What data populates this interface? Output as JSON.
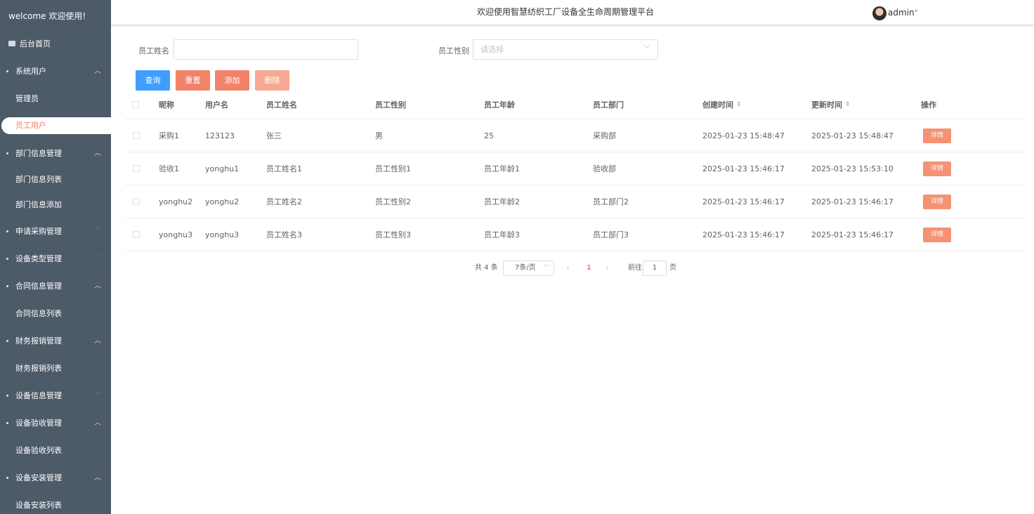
{
  "sidebar": {
    "welcome": "welcome 欢迎使用!",
    "home": "后台首页",
    "groups": [
      {
        "label": "系统用户",
        "children": [
          "管理员"
        ],
        "active_child": "员工用户"
      },
      {
        "label": "部门信息管理",
        "children": [
          "部门信息列表",
          "部门信息添加"
        ]
      },
      {
        "label": "申请采购管理"
      },
      {
        "label": "设备类型管理"
      },
      {
        "label": "合同信息管理",
        "children": [
          "合同信息列表"
        ]
      },
      {
        "label": "财务报销管理",
        "children": [
          "财务报销列表"
        ]
      },
      {
        "label": "设备信息管理"
      },
      {
        "label": "设备验收管理",
        "children": [
          "设备验收列表"
        ]
      },
      {
        "label": "设备安装管理",
        "children": [
          "设备安装列表"
        ]
      }
    ]
  },
  "header": {
    "title": "欢迎使用智慧纺织工厂设备全生命周期管理平台",
    "user": "admin",
    "user_caret": "˅"
  },
  "search": {
    "name_label": "员工姓名",
    "name_value": "",
    "gender_label": "员工性别",
    "gender_placeholder": "请选择"
  },
  "buttons": {
    "query": "查询",
    "reset": "重置",
    "add": "添加",
    "delete": "删除"
  },
  "colors": {
    "sidebar_bg": "#4d5a68",
    "primary": "#409eff",
    "accent": "#f2836b",
    "delete_disabled": "#f7a891",
    "detail_btn": "#f59274"
  },
  "table": {
    "headers": [
      "昵称",
      "用户名",
      "员工姓名",
      "员工性别",
      "员工年龄",
      "员工部门",
      "创建时间",
      "更新时间",
      "操作"
    ],
    "sort_icon": "⇕",
    "rows": [
      {
        "nickname": "采购1",
        "username": "123123",
        "name": "张三",
        "gender": "男",
        "age": "25",
        "dept": "采购部",
        "created": "2025-01-23 15:48:47",
        "updated": "2025-01-23 15:48:47",
        "action": "详情"
      },
      {
        "nickname": "验收1",
        "username": "yonghu1",
        "name": "员工姓名1",
        "gender": "员工性别1",
        "age": "员工年龄1",
        "dept": "验收部",
        "created": "2025-01-23 15:46:17",
        "updated": "2025-01-23 15:53:10",
        "action": "详情"
      },
      {
        "nickname": "yonghu2",
        "username": "yonghu2",
        "name": "员工姓名2",
        "gender": "员工性别2",
        "age": "员工年龄2",
        "dept": "员工部门2",
        "created": "2025-01-23 15:46:17",
        "updated": "2025-01-23 15:46:17",
        "action": "详情"
      },
      {
        "nickname": "yonghu3",
        "username": "yonghu3",
        "name": "员工姓名3",
        "gender": "员工性别3",
        "age": "员工年龄3",
        "dept": "员工部门3",
        "created": "2025-01-23 15:46:17",
        "updated": "2025-01-23 15:46:17",
        "action": "详情"
      }
    ]
  },
  "pagination": {
    "total": "共 4 条",
    "page_size": "7条/页",
    "prev": "‹",
    "current": "1",
    "next": "›",
    "goto_label": "前往",
    "goto_value": "1",
    "goto_unit": "页"
  }
}
